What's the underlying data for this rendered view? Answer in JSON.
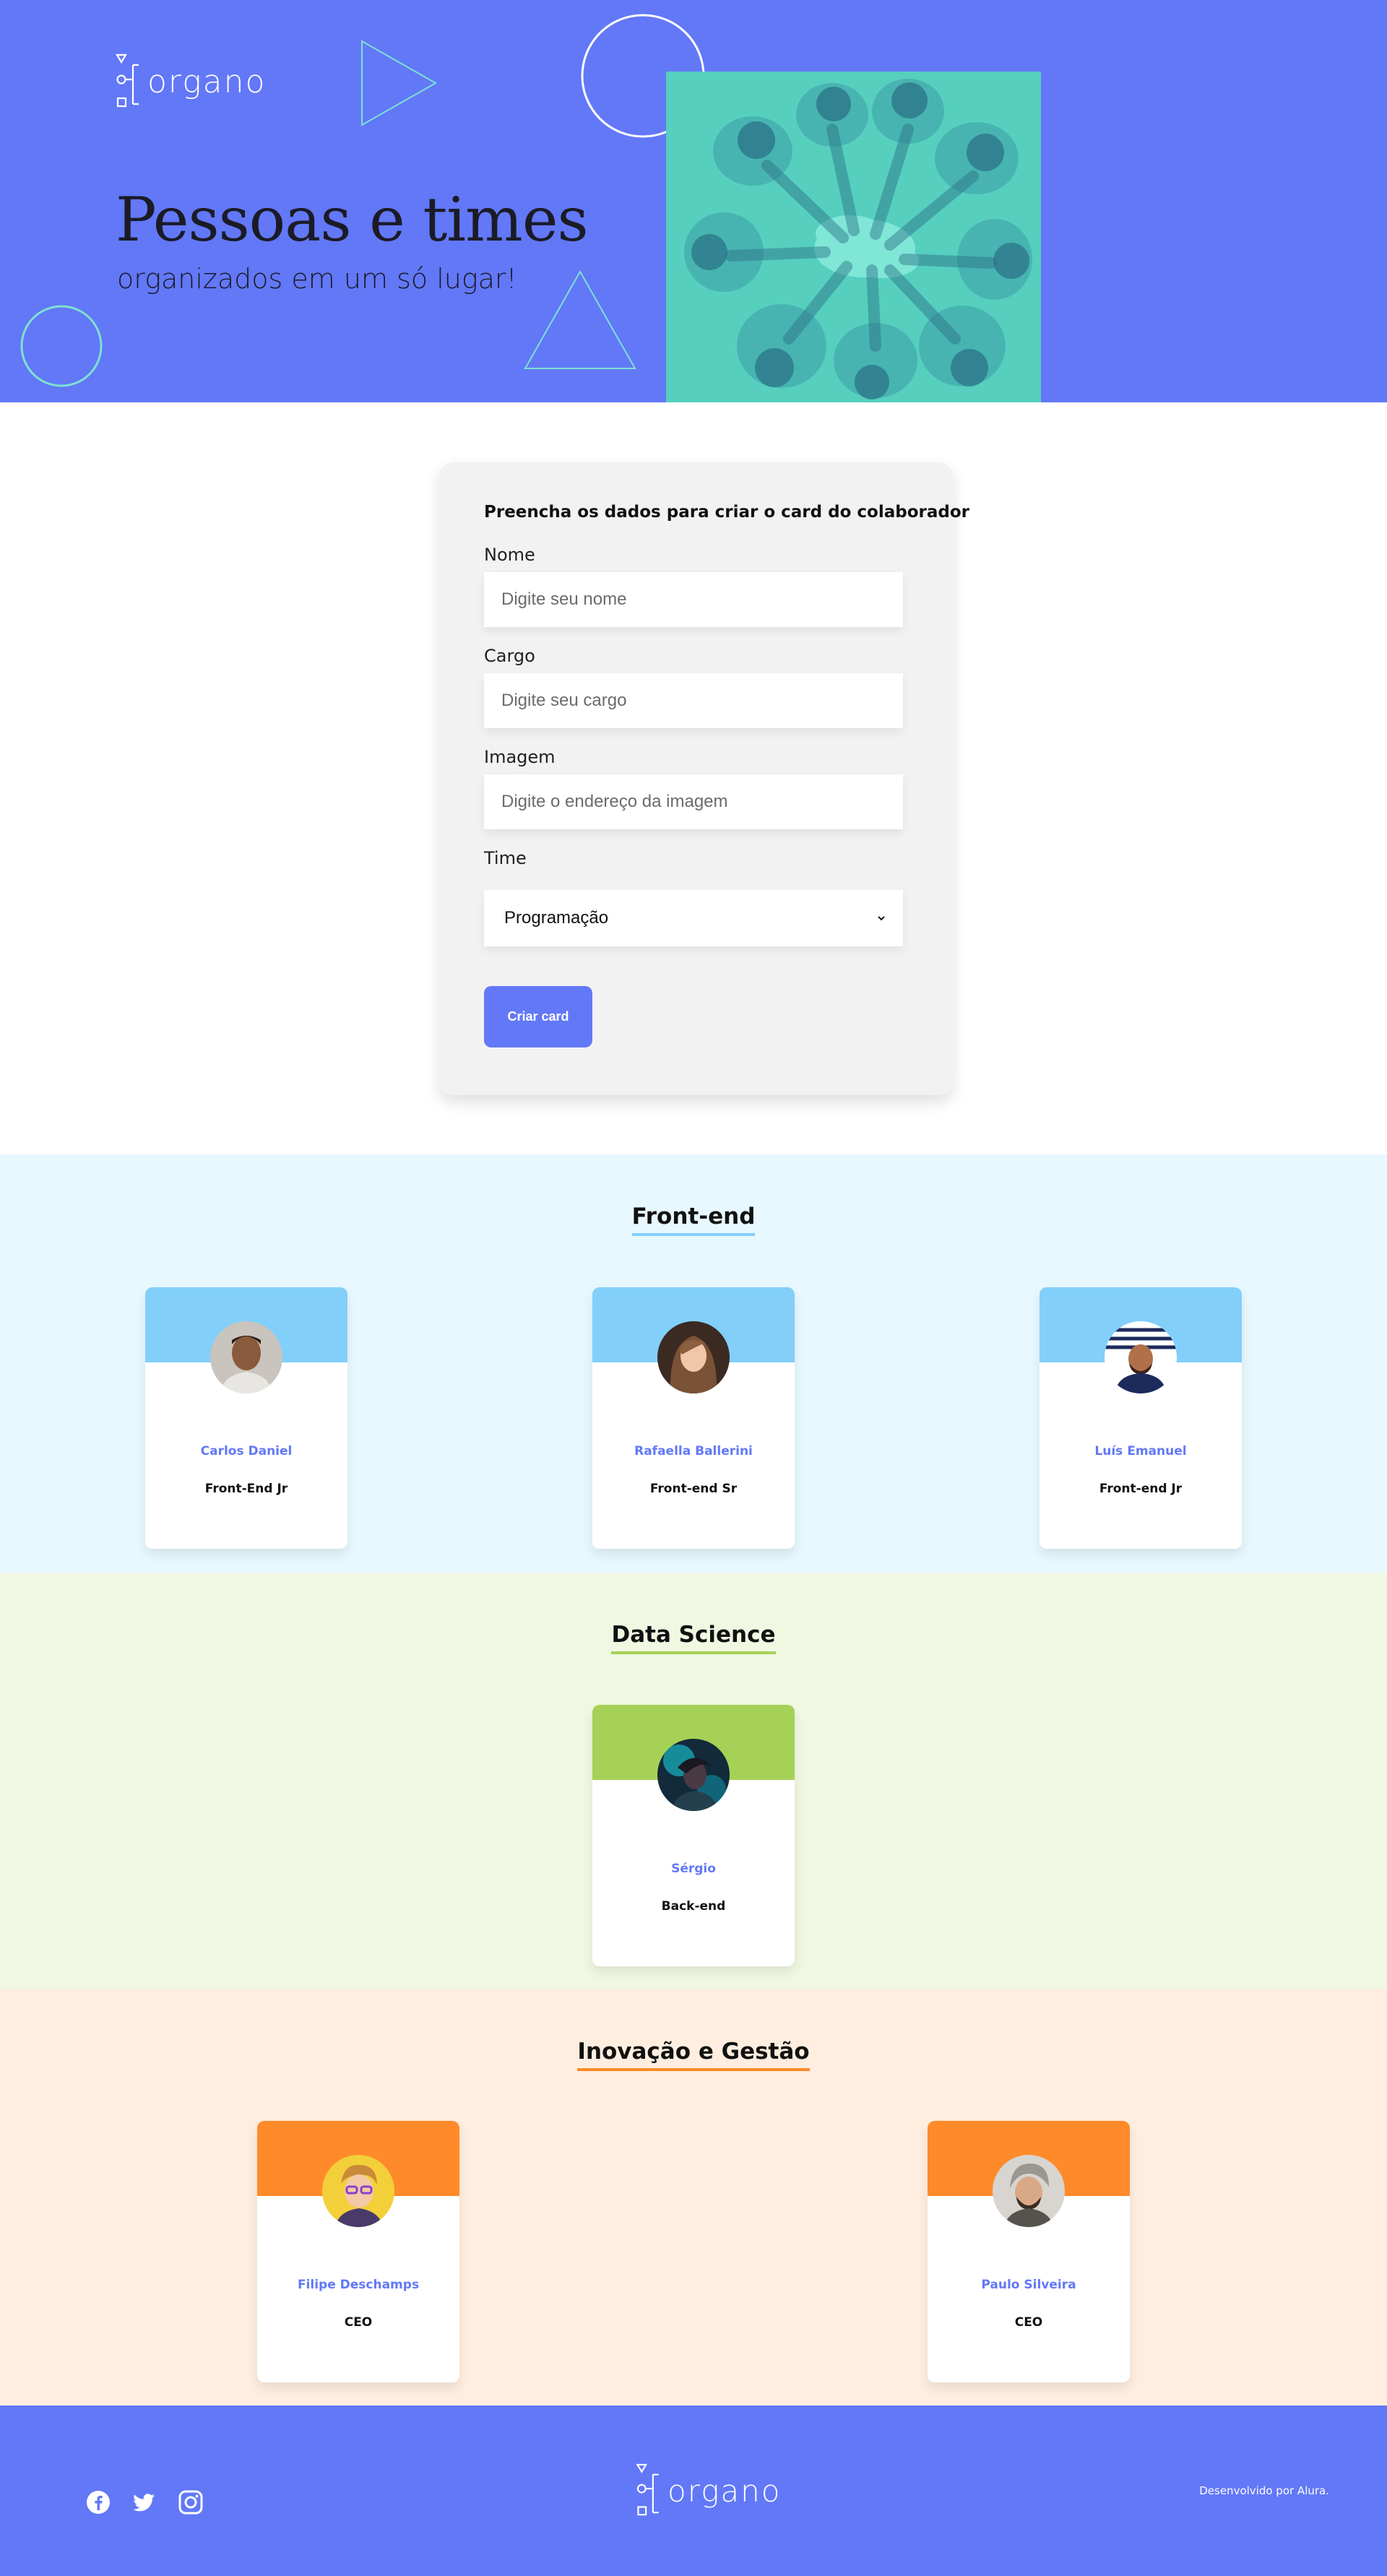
{
  "brand": {
    "logo_text": "organo",
    "primary_color": "#6278f7",
    "hero_photo_tint": "#5ad5c4"
  },
  "hero": {
    "title": "Pessoas e times",
    "subtitle": "organizados em um só lugar!"
  },
  "form": {
    "heading": "Preencha os dados para criar o card do colaborador",
    "fields": [
      {
        "label": "Nome",
        "placeholder": "Digite seu nome",
        "value": ""
      },
      {
        "label": "Cargo",
        "placeholder": "Digite seu cargo",
        "value": ""
      },
      {
        "label": "Imagem",
        "placeholder": "Digite o endereço da imagem",
        "value": ""
      }
    ],
    "team_select": {
      "label": "Time",
      "selected": "Programação"
    },
    "submit_label": "Criar card"
  },
  "teams": [
    {
      "name": "Front-end",
      "primary_color": "#82cffa",
      "secondary_color": "#e8f8ff",
      "members": [
        {
          "name": "Carlos Daniel",
          "role": "Front-End Jr"
        },
        {
          "name": "Rafaella Ballerini",
          "role": "Front-end Sr"
        },
        {
          "name": "Luís Emanuel",
          "role": "Front-end Jr"
        }
      ]
    },
    {
      "name": "Data Science",
      "primary_color": "#a6d157",
      "secondary_color": "#f0f8e2",
      "members": [
        {
          "name": "Sérgio",
          "role": "Back-end"
        }
      ]
    },
    {
      "name": "Inovação e Gestão",
      "primary_color": "#ff8a29",
      "secondary_color": "#ffeedf",
      "members": [
        {
          "name": "Filipe Deschamps",
          "role": "CEO"
        },
        {
          "name": "Paulo Silveira",
          "role": "CEO"
        }
      ]
    }
  ],
  "footer": {
    "social": [
      "facebook-icon",
      "twitter-icon",
      "instagram-icon"
    ],
    "credit": "Desenvolvido por Alura."
  }
}
